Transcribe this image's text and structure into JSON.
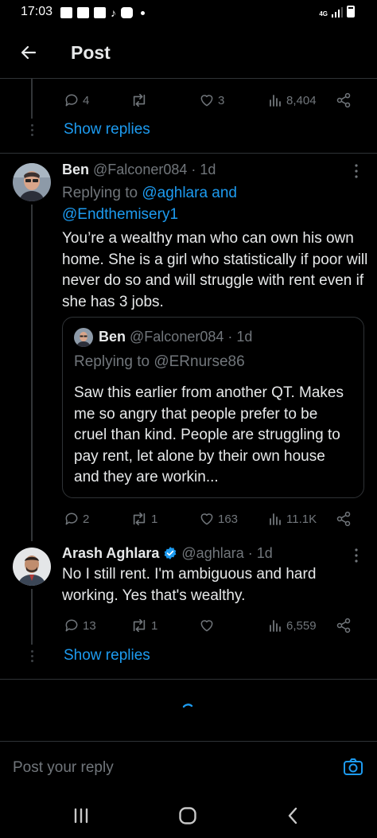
{
  "status_bar": {
    "time": "17:03",
    "network": "4G"
  },
  "header": {
    "title": "Post"
  },
  "top_tweet": {
    "replies": "4",
    "retweets": "",
    "likes": "3",
    "views": "8,404",
    "show_replies": "Show replies"
  },
  "ben_reply": {
    "name": "Ben",
    "handle": "@Falconer084",
    "time": "· 1d",
    "replying_prefix": "Replying to ",
    "replying_to_1": "@aghlara",
    "replying_and": " and",
    "replying_to_2": "@Endthemisery1",
    "text": "You’re a wealthy man who can own his own home. She is a girl who statistically if poor will never do so and will struggle with rent even if she has 3 jobs.",
    "quote": {
      "name": "Ben",
      "handle": "@Falconer084",
      "time": "· 1d",
      "replying": "Replying to @ERnurse86",
      "text": "Saw this earlier from another QT. Makes me so angry that people prefer to be cruel than kind. People are struggling to pay rent, let alone by their own house and they are workin..."
    },
    "replies": "2",
    "retweets": "1",
    "likes": "163",
    "views": "11.1K"
  },
  "arash_reply": {
    "name": "Arash Aghlara",
    "handle": "@aghlara",
    "time": "· 1d",
    "text": "No I still rent. I'm ambiguous and hard working. Yes that's wealthy.",
    "replies": "13",
    "retweets": "1",
    "likes": "",
    "views": "6,559",
    "show_replies": "Show replies"
  },
  "reply_bar": {
    "placeholder": "Post your reply"
  },
  "colors": {
    "accent": "#1d9bf0",
    "muted": "#71767b",
    "text": "#e7e9ea",
    "background": "#000000"
  },
  "icons": [
    "arrow-left-icon",
    "reply-icon",
    "retweet-icon",
    "heart-icon",
    "views-icon",
    "share-icon",
    "more-icon",
    "verified-icon",
    "camera-icon",
    "recents-icon",
    "home-icon",
    "back-nav-icon"
  ]
}
